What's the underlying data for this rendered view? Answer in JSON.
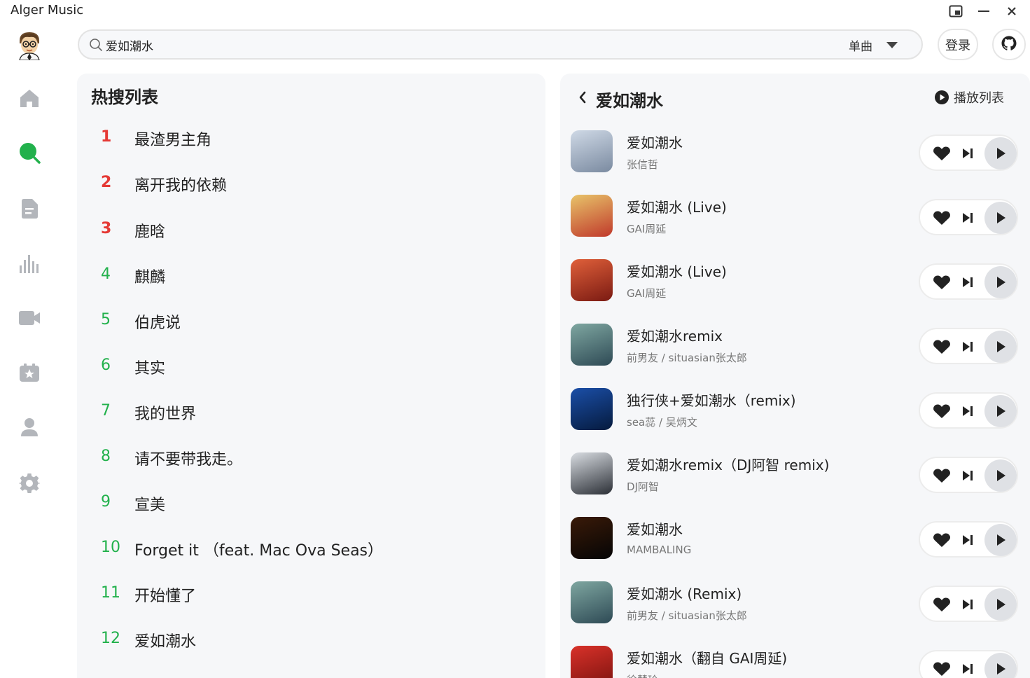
{
  "app": {
    "title": "Alger Music"
  },
  "window": {
    "pip_icon": "picture-in-picture-icon",
    "minimize_icon": "minimize-icon",
    "close_icon": "close-icon"
  },
  "sidebar": {
    "items": [
      {
        "name": "home",
        "icon": "home-icon",
        "active": false
      },
      {
        "name": "search",
        "icon": "search-icon",
        "active": true
      },
      {
        "name": "playlist",
        "icon": "document-icon",
        "active": false
      },
      {
        "name": "charts",
        "icon": "bar-chart-icon",
        "active": false
      },
      {
        "name": "video",
        "icon": "video-icon",
        "active": false
      },
      {
        "name": "favorites",
        "icon": "star-box-icon",
        "active": false
      },
      {
        "name": "user",
        "icon": "user-icon",
        "active": false
      },
      {
        "name": "settings",
        "icon": "gear-icon",
        "active": false
      }
    ]
  },
  "search": {
    "value": "爱如潮水",
    "type_selected": "单曲"
  },
  "header": {
    "login_label": "登录"
  },
  "hot": {
    "title": "热搜列表",
    "items": [
      {
        "rank": "1",
        "word": "最渣男主角"
      },
      {
        "rank": "2",
        "word": "离开我的依赖"
      },
      {
        "rank": "3",
        "word": "鹿晗"
      },
      {
        "rank": "4",
        "word": "麒麟"
      },
      {
        "rank": "5",
        "word": "伯虎说"
      },
      {
        "rank": "6",
        "word": "其实"
      },
      {
        "rank": "7",
        "word": "我的世界"
      },
      {
        "rank": "8",
        "word": "请不要带我走。"
      },
      {
        "rank": "9",
        "word": "宣美"
      },
      {
        "rank": "10",
        "word": "Forget it （feat. Mac Ova Seas）"
      },
      {
        "rank": "11",
        "word": "开始懂了"
      },
      {
        "rank": "12",
        "word": "爱如潮水"
      }
    ]
  },
  "results": {
    "title": "爱如潮水",
    "playlist_label": "播放列表",
    "songs": [
      {
        "name": "爱如潮水",
        "artist": "张信哲",
        "cover_colors": [
          "#cfd9e6",
          "#7a8aa0"
        ]
      },
      {
        "name": "爱如潮水 (Live)",
        "artist": "GAI周延",
        "cover_colors": [
          "#e8c46a",
          "#c0392b"
        ]
      },
      {
        "name": "爱如潮水 (Live)",
        "artist": "GAI周延",
        "cover_colors": [
          "#e0603a",
          "#7a1a12"
        ]
      },
      {
        "name": "爱如潮水remix",
        "artist": "前男友 / situasian张太郎",
        "cover_colors": [
          "#7fa7a1",
          "#2e4a55"
        ]
      },
      {
        "name": "独行侠+爱如潮水（remix)",
        "artist": "sea蕊 / 吴炳文",
        "cover_colors": [
          "#1b4fa8",
          "#051a3d"
        ]
      },
      {
        "name": "爱如潮水remix（DJ阿智 remix)",
        "artist": "DJ阿智",
        "cover_colors": [
          "#d9dde2",
          "#2b2f36"
        ]
      },
      {
        "name": "爱如潮水",
        "artist": "MAMBALING",
        "cover_colors": [
          "#3a1a08",
          "#050505"
        ]
      },
      {
        "name": "爱如潮水 (Remix)",
        "artist": "前男友 / situasian张太郎",
        "cover_colors": [
          "#7fa7a1",
          "#2e4a55"
        ]
      },
      {
        "name": "爱如潮水（翻自 GAI周延)",
        "artist": "徐慧玲",
        "cover_colors": [
          "#d9322a",
          "#7a120e"
        ]
      }
    ]
  },
  "colors": {
    "accent": "#22b14c",
    "top_rank": "#e53935",
    "panel_bg": "#f6f7f9"
  }
}
